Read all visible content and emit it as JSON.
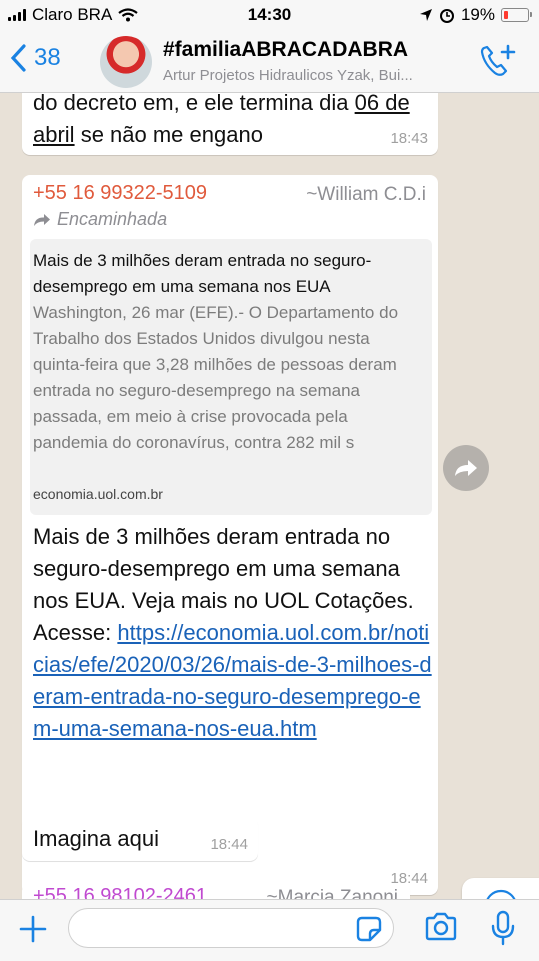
{
  "status_bar": {
    "carrier": "Claro BRA",
    "time": "14:30",
    "battery": "19%",
    "battery_level": 0.19
  },
  "header": {
    "back_count": "38",
    "group_name": "#familiaABRACADABRA",
    "participants": "Artur Projetos Hidraulicos Yzak, Bui..."
  },
  "messages": [
    {
      "text_parts": [
        "do decreto em, e ele termina dia ",
        "06 de abril",
        " se não me engano"
      ],
      "time": "18:43"
    },
    {
      "sender_phone": "+55 16 99322-5109",
      "sender_name": "~William C.D.i",
      "forwarded_label": "Encaminhada",
      "preview": {
        "title": "Mais de 3 milhões deram entrada no seguro-desemprego em uma semana nos EUA",
        "description": "Washington, 26 mar (EFE).- O Departamento do Trabalho dos Estados Unidos divulgou nesta quinta-feira que 3,28 milhões de pessoas deram entrada no seguro-desemprego na semana passada, em meio à crise provocada pela pandemia do coronavírus, contra 282 mil s",
        "domain": "economia.uol.com.br"
      },
      "text": "Mais de 3 milhões deram entrada no seguro-desemprego em uma semana nos EUA. Veja mais no UOL Cotações. Acesse: ",
      "link": "https://economia.uol.com.br/noticias/efe/2020/03/26/mais-de-3-milhoes-deram-entrada-no-seguro-desemprego-em-uma-semana-nos-eua.htm",
      "time": "18:44"
    },
    {
      "text": "Imagina aqui",
      "time": "18:44"
    },
    {
      "sender_phone": "+55 16 98102-2461",
      "sender_name": "~Marcia Zanoni"
    }
  ],
  "input": {
    "placeholder": ""
  },
  "icons": {
    "back": "chevron-left-icon",
    "call": "add-call-icon",
    "forward": "forward-icon",
    "scroll": "scroll-down-icon",
    "plus": "plus-icon",
    "sticker": "sticker-icon",
    "camera": "camera-icon",
    "mic": "microphone-icon"
  },
  "colors": {
    "accent": "#1a82e2",
    "sender1": "#e05a3c",
    "sender2": "#c04ad0",
    "link": "#1a62b8"
  }
}
